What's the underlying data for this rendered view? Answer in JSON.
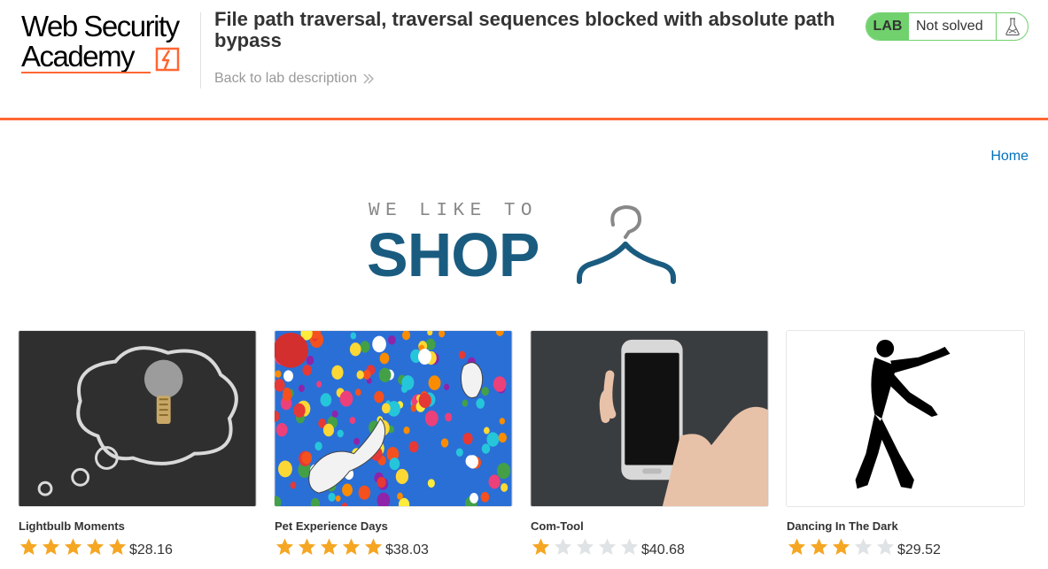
{
  "header": {
    "logo_line1": "Web Security",
    "logo_line2": "Academy",
    "lab_title": "File path traversal, traversal sequences blocked with absolute path bypass",
    "back_link": "Back to lab description",
    "lab_badge": "LAB",
    "lab_status": "Not solved",
    "accent_color": "#ff6633",
    "status_color": "#70d16d"
  },
  "nav": {
    "home": "Home"
  },
  "shop_logo": {
    "tagline": "WE LIKE TO",
    "word": "SHOP",
    "color": "#1a5c80"
  },
  "products": [
    {
      "name": "Lightbulb Moments",
      "rating": 5,
      "price": "$28.16",
      "image_icon": "lightbulb-chalk-image"
    },
    {
      "name": "Pet Experience Days",
      "rating": 5,
      "price": "$38.03",
      "image_icon": "balloons-dog-image"
    },
    {
      "name": "Com-Tool",
      "rating": 1,
      "price": "$40.68",
      "image_icon": "smartphone-hand-image"
    },
    {
      "name": "Dancing In The Dark",
      "rating": 3,
      "price": "$29.52",
      "image_icon": "dancing-silhouette-image"
    }
  ],
  "star_colors": {
    "filled": "#f5a623",
    "empty": "#dfe3e6"
  }
}
